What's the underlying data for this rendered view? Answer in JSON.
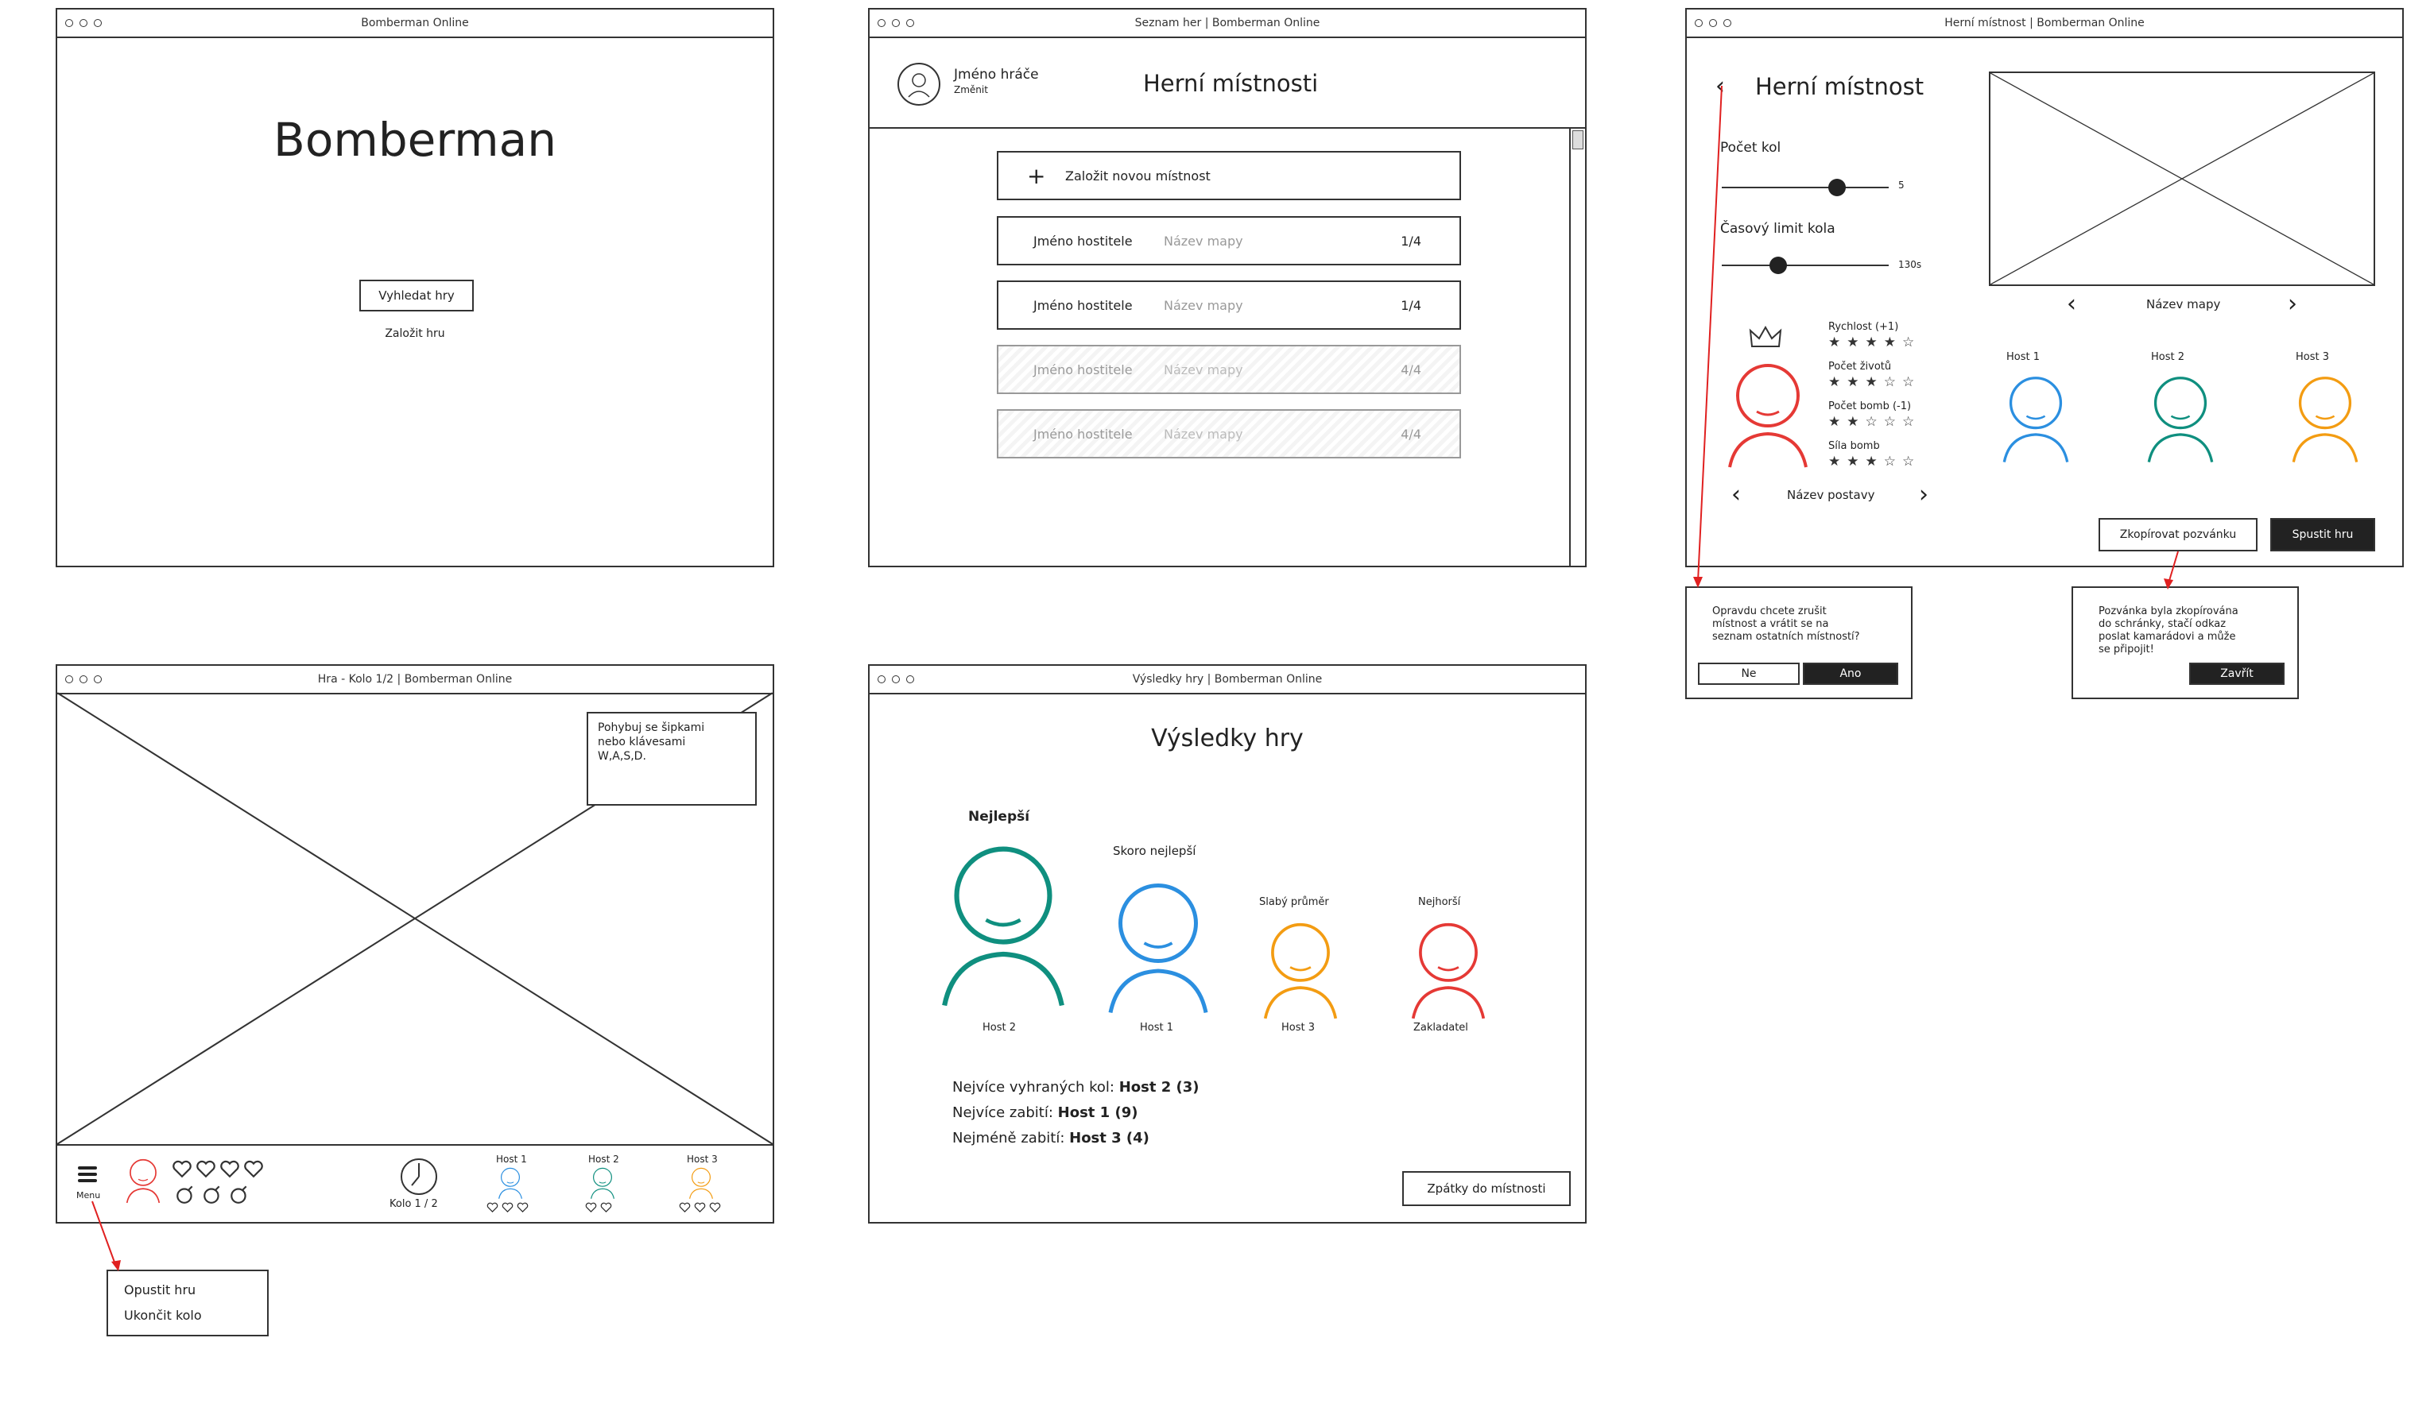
{
  "window1": {
    "title": "Bomberman Online",
    "heading": "Bomberman",
    "search_button": "Vyhledat hry",
    "create_link": "Založit hru"
  },
  "window2": {
    "title": "Seznam her | Bomberman Online",
    "player_name": "Jméno hráče",
    "change_link": "Změnit",
    "heading": "Herní místnosti",
    "new_room": "Založit novou místnost",
    "rooms": [
      {
        "host": "Jméno hostitele",
        "map": "Název mapy",
        "count": "1/4"
      },
      {
        "host": "Jméno hostitele",
        "map": "Název mapy",
        "count": "1/4"
      },
      {
        "host": "Jméno hostitele",
        "map": "Název mapy",
        "count": "4/4"
      },
      {
        "host": "Jméno hostitele",
        "map": "Název mapy",
        "count": "4/4"
      }
    ]
  },
  "window3": {
    "title": "Herní místnost | Bomberman Online",
    "heading": "Herní místnost",
    "rounds_label": "Počet kol",
    "rounds_value": "5",
    "time_label": "Časový limit kola",
    "time_value": "130s",
    "stats": [
      {
        "label": "Rychlost (+1)",
        "stars": "★★★★☆"
      },
      {
        "label": "Počet životů",
        "stars": "★★★☆☆"
      },
      {
        "label": "Počet bomb (-1)",
        "stars": "★★☆☆☆"
      },
      {
        "label": "Síla bomb",
        "stars": "★★★☆☆"
      }
    ],
    "character_name": "Název postavy",
    "map_name": "Název mapy",
    "guests": [
      "Host 1",
      "Host 2",
      "Host 3"
    ],
    "copy_button": "Zkopírovat pozvánku",
    "start_button": "Spustit hru"
  },
  "popup_cancel": {
    "text": [
      "Opravdu chcete zrušit",
      "místnost a vrátit se na",
      "seznam ostatních místností?"
    ],
    "no": "Ne",
    "yes": "Ano"
  },
  "popup_copied": {
    "text": [
      "Pozvánka byla zkopírována",
      "do schránky, stačí odkaz",
      "poslat kamarádovi a může",
      "se připojit!"
    ],
    "close": "Zavřít"
  },
  "window4": {
    "title": "Hra - Kolo 1/2 | Bomberman Online",
    "hint": [
      "Pohybuj se šipkami",
      "nebo klávesami",
      "W,A,S,D."
    ],
    "menu_label": "Menu",
    "round_label": "Kolo 1 / 2",
    "guests": [
      "Host 1",
      "Host 2",
      "Host 3"
    ]
  },
  "menu_popup": {
    "items": [
      "Opustit hru",
      "Ukončit kolo"
    ]
  },
  "window5": {
    "title": "Výsledky hry | Bomberman Online",
    "heading": "Výsledky hry",
    "ranks": [
      {
        "rank": "Nejlepší",
        "name": "Host 2",
        "color": "#0f8f7f"
      },
      {
        "rank": "Skoro nejlepší",
        "name": "Host 1",
        "color": "#2b8fe0"
      },
      {
        "rank": "Slabý průměr",
        "name": "Host 3",
        "color": "#f39c12"
      },
      {
        "rank": "Nejhorší",
        "name": "Zakladatel",
        "color": "#e53935"
      }
    ],
    "stats": [
      {
        "label": "Nejvíce vyhraných kol:",
        "value": "Host 2 (3)"
      },
      {
        "label": "Nejvíce zabití:",
        "value": "Host 1 (9)"
      },
      {
        "label": "Nejméně zabití:",
        "value": "Host 3 (4)"
      }
    ],
    "back_button": "Zpátky do místnosti"
  },
  "colors": {
    "red": "#e53935",
    "blue": "#2b8fe0",
    "teal": "#0f8f7f",
    "orange": "#f39c12",
    "arrow": "#e02020"
  }
}
